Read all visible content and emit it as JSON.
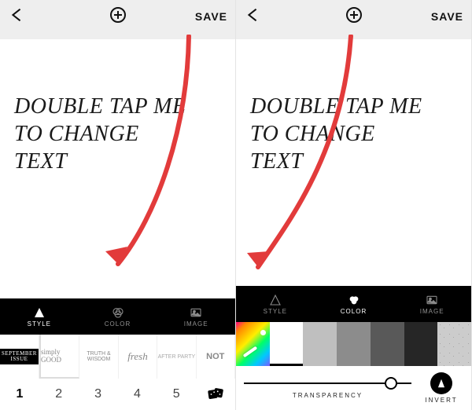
{
  "left": {
    "topbar": {
      "back": "back",
      "add": "add",
      "save": "SAVE"
    },
    "placeholder": {
      "line1": "DOUBLE TAP ME",
      "line2": "TO CHANGE",
      "line3": "TEXT"
    },
    "tabs": {
      "style": "STYLE",
      "color": "COLOR",
      "image": "IMAGE",
      "selected": "style"
    },
    "style_thumbs": [
      {
        "name": "september-issue",
        "text1": "SEPTEMBER",
        "text2": "ISSUE"
      },
      {
        "name": "simply-good",
        "text": "simply GOOD"
      },
      {
        "name": "truth-wisdom",
        "text": "TRUTH & WISDOM"
      },
      {
        "name": "fresh",
        "text": "fresh"
      },
      {
        "name": "after-party",
        "text": "AFTER PARTY"
      },
      {
        "name": "not",
        "text": "NOT"
      }
    ],
    "pages": {
      "values": [
        "1",
        "2",
        "3",
        "4",
        "5"
      ],
      "active": 0,
      "dice": "dice"
    }
  },
  "right": {
    "topbar": {
      "back": "back",
      "add": "add",
      "save": "SAVE"
    },
    "placeholder": {
      "line1": "DOUBLE TAP ME",
      "line2": "TO CHANGE",
      "line3": "TEXT"
    },
    "tabs": {
      "style": "STYLE",
      "color": "COLOR",
      "image": "IMAGE",
      "selected": "color"
    },
    "color_swatches": [
      {
        "name": "rainbow-picker",
        "kind": "rainbow"
      },
      {
        "name": "white",
        "hex": "#ffffff"
      },
      {
        "name": "gray-1",
        "hex": "#bfbfbf"
      },
      {
        "name": "gray-2",
        "hex": "#8c8c8c"
      },
      {
        "name": "gray-3",
        "hex": "#595959"
      },
      {
        "name": "gray-4",
        "hex": "#262626"
      },
      {
        "name": "pattern",
        "kind": "pattern"
      }
    ],
    "transparency": {
      "label": "TRANSPARENCY",
      "value_pct": 88
    },
    "invert": {
      "label": "INVERT"
    }
  }
}
